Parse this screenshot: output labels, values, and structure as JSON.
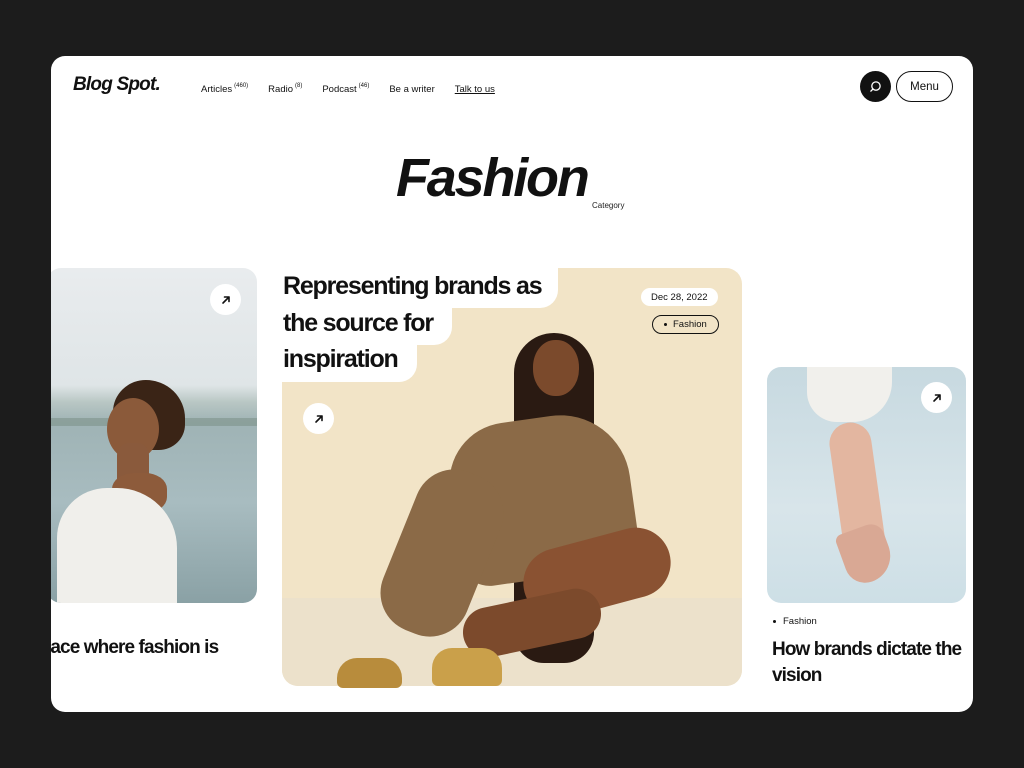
{
  "header": {
    "logo": "Blog Spot.",
    "nav": [
      {
        "label": "Articles",
        "count": "(460)"
      },
      {
        "label": "Radio",
        "count": "(8)"
      },
      {
        "label": "Podcast",
        "count": "(46)"
      },
      {
        "label": "Be a writer",
        "count": ""
      },
      {
        "label": "Talk to us",
        "count": ""
      }
    ],
    "search_icon": "search-icon",
    "menu_label": "Menu"
  },
  "hero": {
    "title": "Fashion",
    "subtitle": "Category"
  },
  "cards": {
    "left": {
      "caption": "lace where fashion is",
      "icon": "arrow-up-right-icon"
    },
    "center": {
      "title_lines": [
        "Representing brands as",
        "the source for",
        "inspiration"
      ],
      "date": "Dec 28, 2022",
      "tag": "Fashion",
      "icon": "arrow-up-right-icon"
    },
    "right": {
      "tag": "Fashion",
      "caption_lines": [
        "How brands dictate the",
        "vision"
      ],
      "icon": "arrow-up-right-icon"
    }
  },
  "colors": {
    "background": "#1c1c1c",
    "page": "#ffffff",
    "accent_dark": "#111111",
    "center_card": "#f2e4c7",
    "right_card": "#cddfe6"
  }
}
